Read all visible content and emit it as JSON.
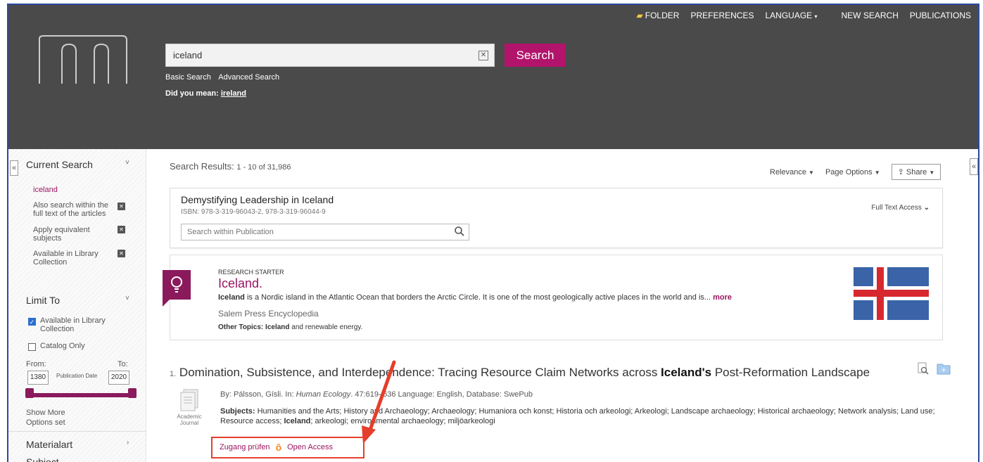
{
  "header": {
    "toplinks": {
      "folder": "FOLDER",
      "preferences": "PREFERENCES",
      "language": "LANGUAGE",
      "new_search": "NEW SEARCH",
      "publications": "PUBLICATIONS"
    },
    "search_value": "iceland",
    "search_button": "Search",
    "basic_search": "Basic Search",
    "advanced_search": "Advanced Search",
    "did_you_mean_label": "Did you mean:",
    "did_you_mean_term": "ireland"
  },
  "sidebar": {
    "current_search_title": "Current Search",
    "current_term": "iceland",
    "facets": [
      "Also search within the full text of the articles",
      "Apply equivalent subjects",
      "Available in Library Collection"
    ],
    "limit_to_title": "Limit To",
    "limit_items": [
      {
        "label": "Available in Library Collection",
        "checked": true
      },
      {
        "label": "Catalog Only",
        "checked": false
      }
    ],
    "from_label": "From:",
    "to_label": "To:",
    "date_from": "1380",
    "date_to": "2020",
    "pub_date_label": "Publication Date",
    "show_more": "Show More",
    "options_set": "Options set",
    "materialart": "Materialart",
    "next_section": "Subject"
  },
  "results": {
    "count_label": "Search Results:",
    "count_range": "1 - 10 of 31,986",
    "relevance": "Relevance",
    "page_options": "Page Options",
    "share": "Share"
  },
  "publication": {
    "title": "Demystifying Leadership in Iceland",
    "isbn": "ISBN: 978-3-319-96043-2, 978-3-319-96044-9",
    "search_placeholder": "Search within Publication",
    "full_text_access": "Full Text Access"
  },
  "research_starter": {
    "label": "RESEARCH STARTER",
    "title": "Iceland.",
    "text_bold": "Iceland",
    "text": " is a Nordic island in the Atlantic Ocean that borders the Arctic Circle. It is one of the most geologically active places in the world and is...",
    "more": "more",
    "source": "Salem Press Encyclopedia",
    "topics_label": "Other Topics:",
    "topics_bold": "Iceland",
    "topics_rest": " and renewable energy."
  },
  "result1": {
    "number": "1.",
    "title_pre": "Domination, Subsistence, and Interdependence: Tracing Resource Claim Networks across ",
    "title_bold": "Iceland's",
    "title_post": " Post-Reformation Landscape",
    "meta_pre": "By: Pálsson, Gísli. In: ",
    "meta_journal": "Human Ecology",
    "meta_post": ". 47:619–636 Language: English, Database: SwePub",
    "subjects_label": "Subjects:",
    "subjects": " Humanities and the Arts; History and Archaeology; Archaeology; Humaniora och konst; Historia och arkeologi; Arkeologi; Landscape archaeology; Historical archaeology; Network analysis; Land use; Resource access; ",
    "subjects_bold": "Iceland",
    "subjects_end": "; arkeologi; environmental archaeology; miljöarkeologi",
    "doc_type": "Academic Journal",
    "access_check": "Zugang prüfen",
    "open_access": "Open Access"
  },
  "colors": {
    "accent": "#9a1560",
    "header_bg": "#4a4a4a",
    "search_btn": "#b2146b",
    "highlight": "#e53e2a"
  }
}
